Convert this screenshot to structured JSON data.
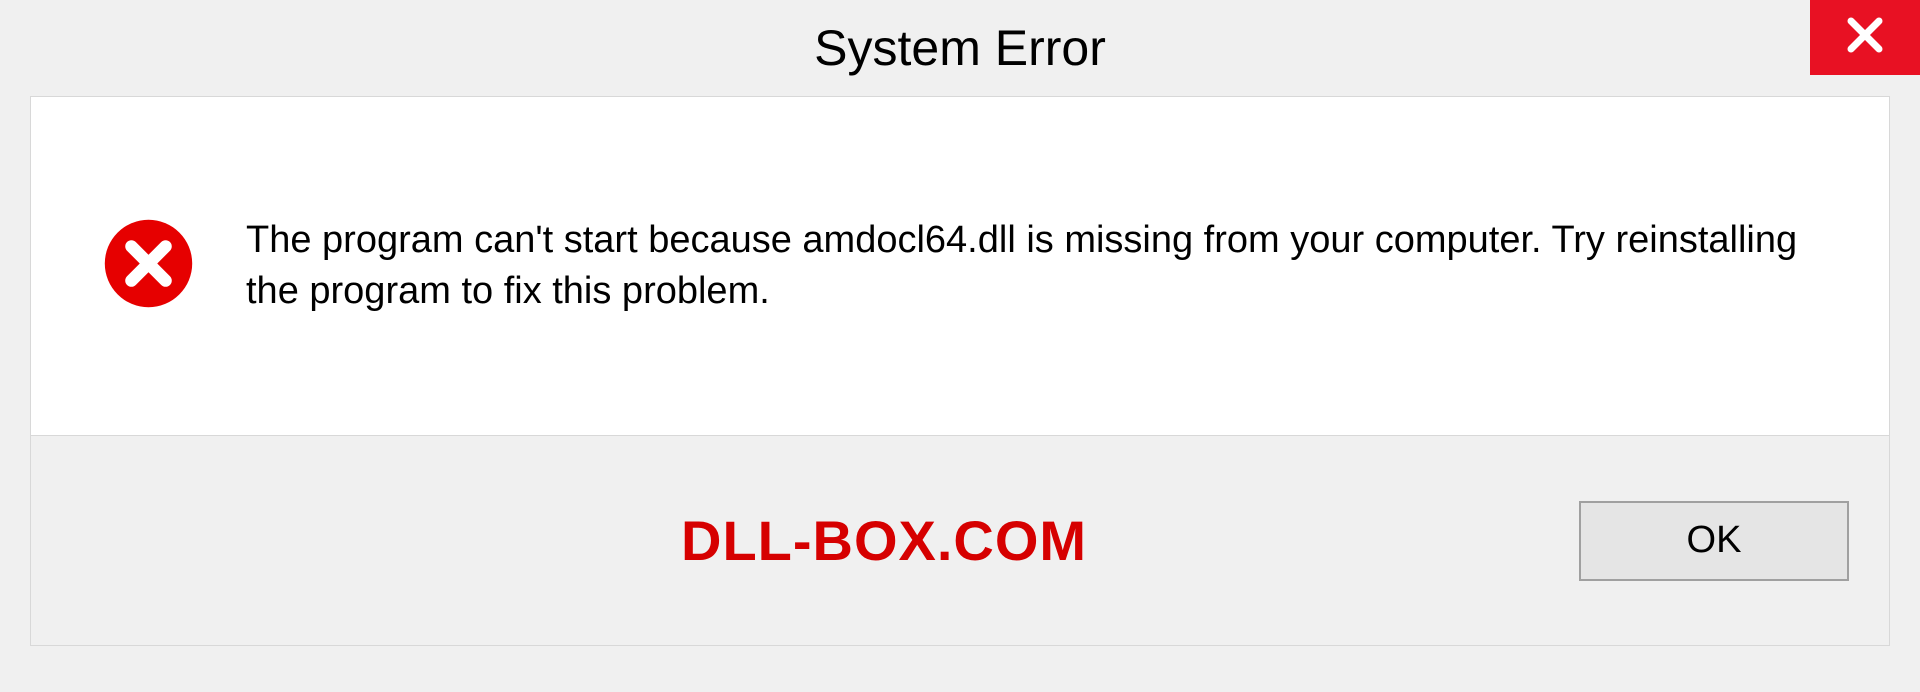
{
  "window": {
    "title": "System Error"
  },
  "message": {
    "text": "The program can't start because amdocl64.dll is missing from your computer. Try reinstalling the program to fix this problem."
  },
  "watermark": {
    "text": "DLL-BOX.COM"
  },
  "buttons": {
    "ok": "OK"
  }
}
